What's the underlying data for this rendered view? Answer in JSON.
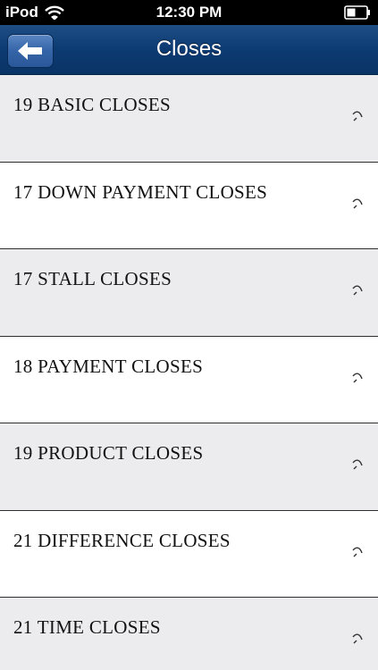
{
  "status_bar": {
    "carrier": "iPod",
    "time": "12:30 PM",
    "wifi_icon": "wifi-icon",
    "battery_icon": "battery-icon"
  },
  "nav_bar": {
    "title": "Closes",
    "back_icon": "back-arrow-icon",
    "color": "#0c3a72"
  },
  "list": {
    "items": [
      {
        "label": "19 BASIC CLOSES"
      },
      {
        "label": "17 DOWN PAYMENT CLOSES"
      },
      {
        "label": "17 STALL CLOSES"
      },
      {
        "label": "18 PAYMENT CLOSES"
      },
      {
        "label": "19 PRODUCT CLOSES"
      },
      {
        "label": "21 DIFFERENCE CLOSES"
      },
      {
        "label": "21 TIME CLOSES"
      }
    ],
    "chevron_icon": "chevron-icon",
    "shaded_color": "#ececef"
  }
}
